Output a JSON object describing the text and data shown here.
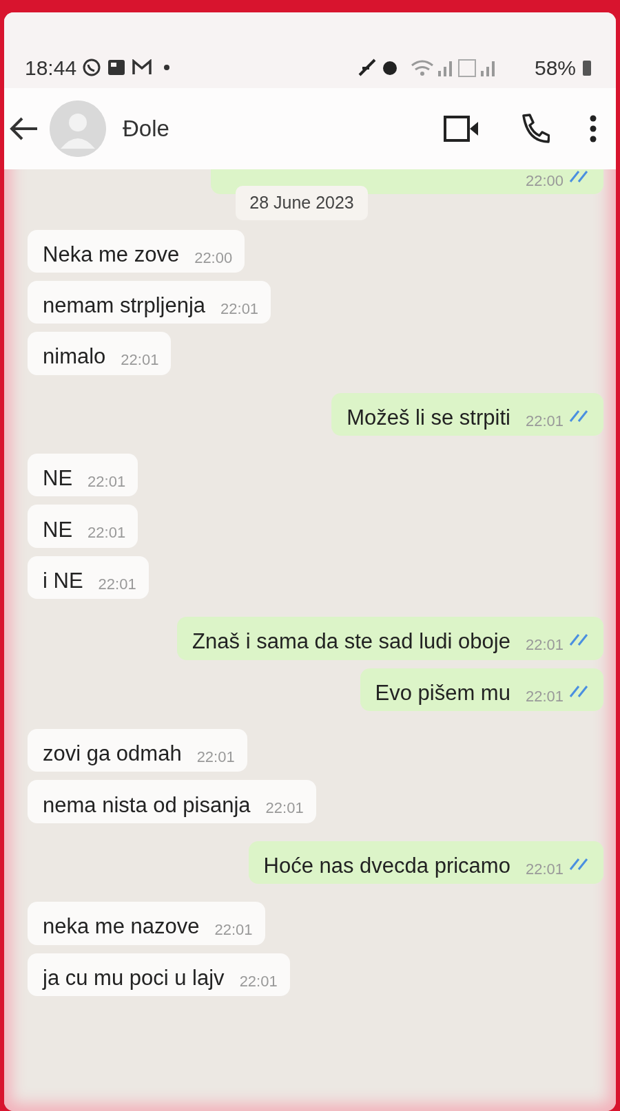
{
  "status_bar": {
    "time": "18:44",
    "battery": "58%"
  },
  "header": {
    "contact_name": "Đole"
  },
  "partial_message": {
    "kind": "out",
    "time": "22:00",
    "read": true
  },
  "date_chip": "28 June 2023",
  "messages": [
    {
      "kind": "in",
      "text": "Neka me zove",
      "time": "22:00"
    },
    {
      "kind": "in",
      "text": "nemam strpljenja",
      "time": "22:01"
    },
    {
      "kind": "in",
      "text": "nimalo",
      "time": "22:01"
    },
    {
      "kind": "out",
      "text": "Možeš li se strpiti",
      "time": "22:01",
      "read": true
    },
    {
      "kind": "in",
      "text": "NE",
      "time": "22:01"
    },
    {
      "kind": "in",
      "text": "NE",
      "time": "22:01"
    },
    {
      "kind": "in",
      "text": "i NE",
      "time": "22:01"
    },
    {
      "kind": "out",
      "text": "Znaš i sama da ste sad ludi oboje",
      "time": "22:01",
      "read": true
    },
    {
      "kind": "out",
      "text": "Evo pišem mu",
      "time": "22:01",
      "read": true
    },
    {
      "kind": "in",
      "text": "zovi ga odmah",
      "time": "22:01"
    },
    {
      "kind": "in",
      "text": "nema nista od pisanja",
      "time": "22:01"
    },
    {
      "kind": "out",
      "text": "Hoće nas dvecda pricamo",
      "time": "22:01",
      "read": true
    },
    {
      "kind": "in",
      "text": "neka me nazove",
      "time": "22:01"
    },
    {
      "kind": "in",
      "text": "ja cu mu poci u lajv",
      "time": "22:01"
    }
  ]
}
